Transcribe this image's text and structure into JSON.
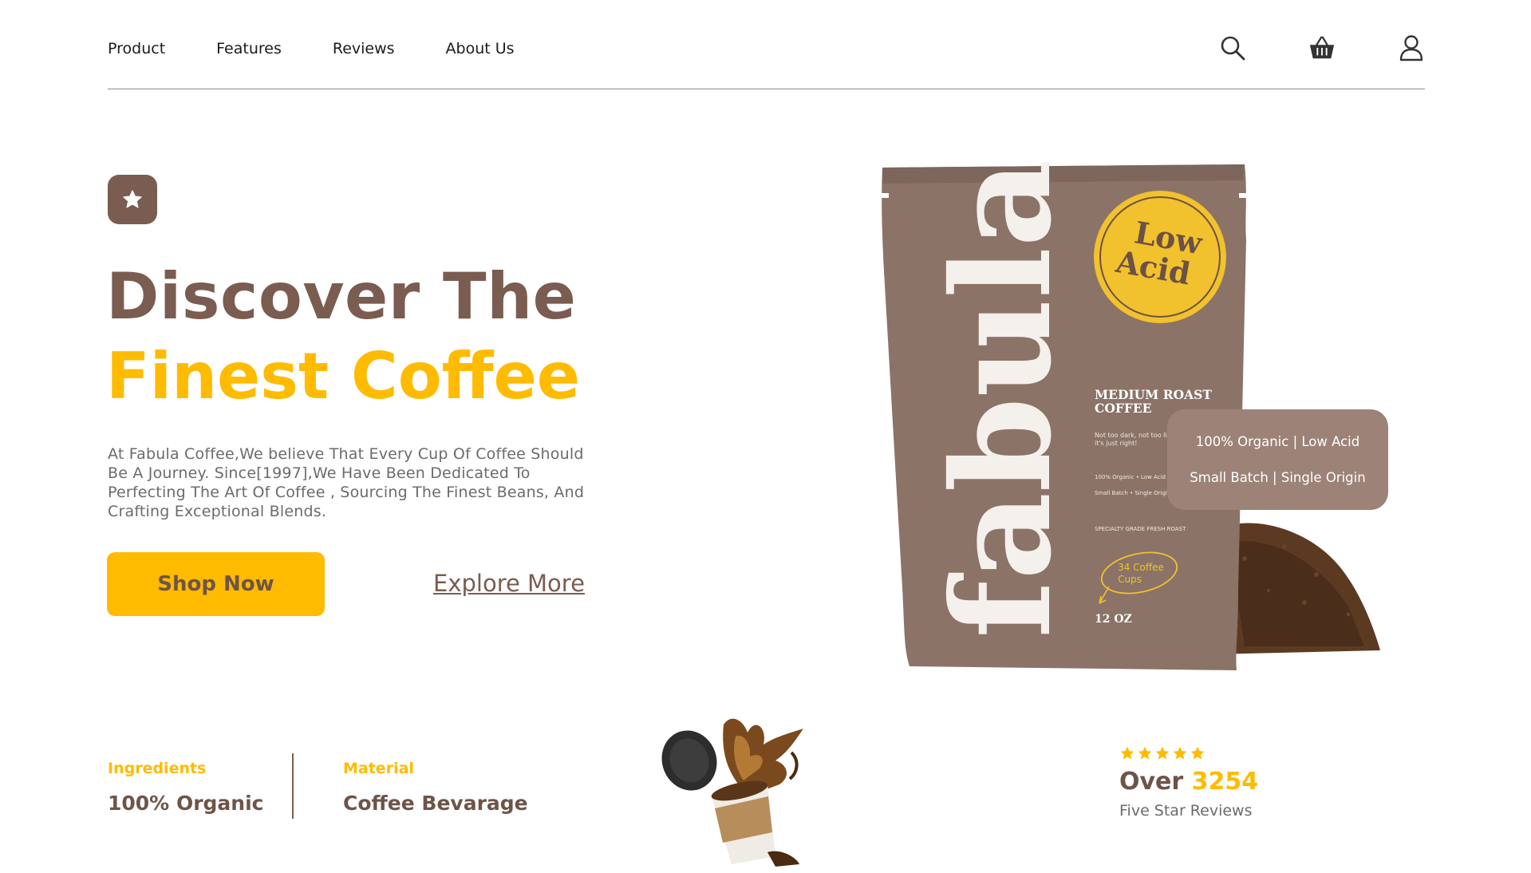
{
  "nav": {
    "links": [
      "Product",
      "Features",
      "Reviews",
      "About Us"
    ],
    "icons": [
      "search-icon",
      "basket-icon",
      "user-icon"
    ]
  },
  "hero": {
    "badge_icon": "star-icon",
    "line1": "Discover The",
    "line2_a": "Finest",
    "line2_b": "Coffee",
    "description": "At Fabula Coffee,We believe That Every Cup Of Coffee Should Be A Journey. Since[1997],We Have Been Dedicated To Perfecting The Art Of Coffee , Sourcing The Finest Beans, And Crafting Exceptional Blends.",
    "shop_label": "Shop Now",
    "explore_label": "Explore More"
  },
  "product": {
    "brand": "fabula",
    "seal_line1": "Low",
    "seal_line2": "Acid",
    "roast_line1": "MEDIUM ROAST",
    "roast_line2": "COFFEE",
    "tagline_line1": "Not too dark, not too light",
    "tagline_line2": "it's just right!",
    "small_line1": "100% Organic • Low Acid",
    "small_line2": "Small Batch • Single Origin",
    "grade": "SPECIALTY GRADE FRESH ROAST",
    "cups_line1": "34 Coffee",
    "cups_line2": "Cups",
    "weight": "12 OZ"
  },
  "feature_card": {
    "line1": "100% Organic | Low Acid",
    "line2": "Small Batch | Single Origin"
  },
  "stats": {
    "ingredients_label": "Ingredients",
    "ingredients_value": "100% Organic",
    "material_label": "Material",
    "material_value": "Coffee Bevarage"
  },
  "reviews": {
    "rating": 5,
    "prefix": "Over",
    "count": "3254",
    "caption": "Five Star Reviews"
  },
  "colors": {
    "brown": "#7a5c50",
    "yellow": "#ffbb00",
    "card": "#9c8277"
  }
}
